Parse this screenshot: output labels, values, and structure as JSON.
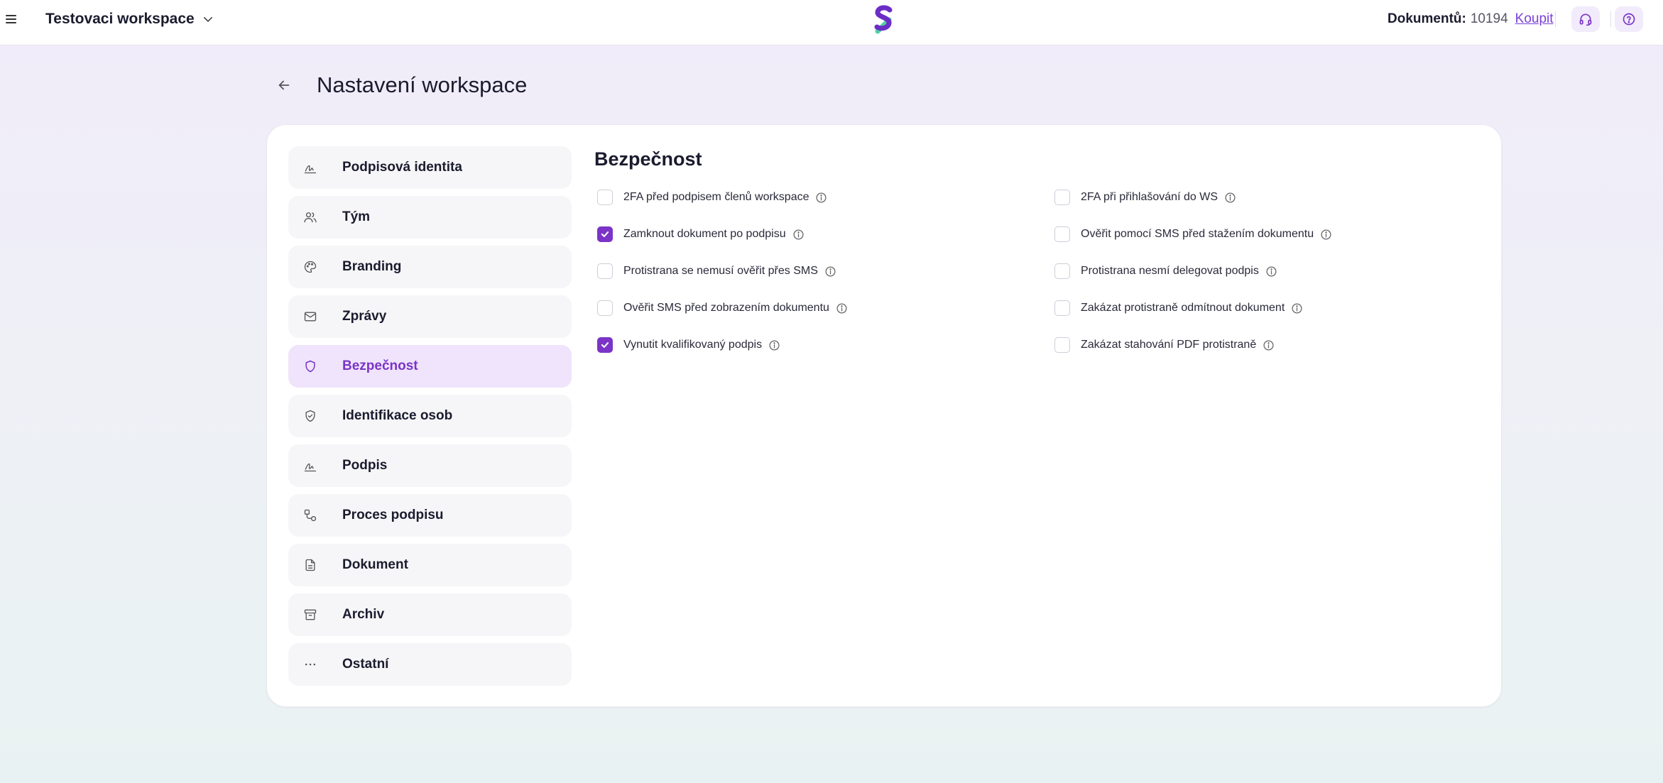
{
  "header": {
    "workspace_name": "Testovaci workspace",
    "docs_label": "Dokumentů:",
    "docs_count": "10194",
    "buy_label": "Koupit",
    "icons": {
      "menu": "hamburger-icon",
      "support": "headset-icon",
      "help": "question-circle-icon"
    },
    "accent_color": "#7b34c7"
  },
  "page": {
    "title": "Nastavení workspace"
  },
  "sidebar": {
    "items": [
      {
        "label": "Podpisová identita",
        "icon": "signature-icon"
      },
      {
        "label": "Tým",
        "icon": "users-icon"
      },
      {
        "label": "Branding",
        "icon": "palette-icon"
      },
      {
        "label": "Zprávy",
        "icon": "mail-icon"
      },
      {
        "label": "Bezpečnost",
        "icon": "shield-icon",
        "active": true
      },
      {
        "label": "Identifikace osob",
        "icon": "shield-check-icon"
      },
      {
        "label": "Podpis",
        "icon": "signature-icon"
      },
      {
        "label": "Proces podpisu",
        "icon": "workflow-icon"
      },
      {
        "label": "Dokument",
        "icon": "document-icon"
      },
      {
        "label": "Archiv",
        "icon": "archive-icon"
      },
      {
        "label": "Ostatní",
        "icon": "ellipsis-icon"
      }
    ]
  },
  "security": {
    "title": "Bezpečnost",
    "options": [
      {
        "label": "2FA před podpisem členů workspace",
        "checked": false
      },
      {
        "label": "2FA při přihlašování do WS",
        "checked": false
      },
      {
        "label": "Zamknout dokument po podpisu",
        "checked": true
      },
      {
        "label": "Ověřit pomocí SMS před stažením dokumentu",
        "checked": false
      },
      {
        "label": "Protistrana se nemusí ověřit přes SMS",
        "checked": false
      },
      {
        "label": "Protistrana nesmí delegovat podpis",
        "checked": false
      },
      {
        "label": "Ověřit SMS před zobrazením dokumentu",
        "checked": false
      },
      {
        "label": "Zakázat protistraně odmítnout dokument",
        "checked": false
      },
      {
        "label": "Vynutit kvalifikovaný podpis",
        "checked": true
      },
      {
        "label": "Zakázat stahování PDF protistraně",
        "checked": false
      }
    ]
  }
}
